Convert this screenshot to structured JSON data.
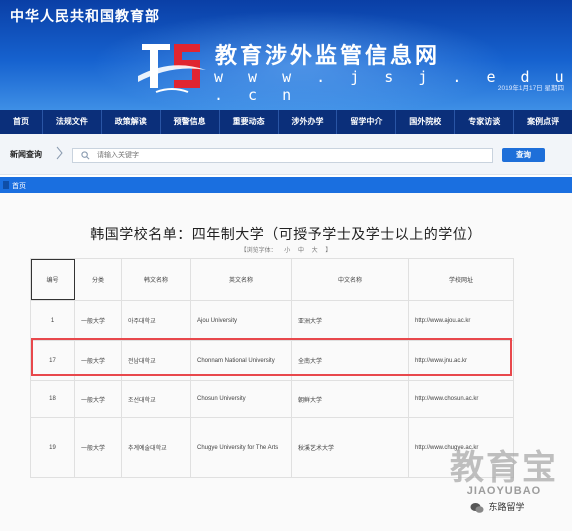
{
  "header": {
    "ministry": "中华人民共和国教育部",
    "site_title": "教育涉外监管信息网",
    "domain": "w w w . j s j . e d u . c n",
    "date": "2019年1月17日 星期四"
  },
  "nav": {
    "items": [
      "首页",
      "法规文件",
      "政策解读",
      "预警信息",
      "重要动态",
      "涉外办学",
      "留学中介",
      "国外院校",
      "专家访谈",
      "案例点评"
    ]
  },
  "search": {
    "label": "新闻查询",
    "placeholder": "请输入关键字",
    "button": "查询"
  },
  "breadcrumb": "首页",
  "page": {
    "title": "韩国学校名单：四年制大学（可授予学士及学士以上的学位）",
    "font_size_label": "【浏览字体：",
    "font_sizes": [
      "小",
      "中",
      "大"
    ],
    "font_size_end": "】"
  },
  "table": {
    "headers": [
      "编号",
      "分类",
      "韩文名称",
      "英文名称",
      "中文名称",
      "学校网址"
    ],
    "rows": [
      [
        "1",
        "一般大学",
        "아주대학교",
        "Ajou University",
        "亚洲大学",
        "http://www.ajou.ac.kr"
      ],
      [
        "17",
        "一般大学",
        "전남대학교",
        "Chonnam National University",
        "全南大学",
        "http://www.jnu.ac.kr"
      ],
      [
        "18",
        "一般大学",
        "조선대학교",
        "Chosun University",
        "朝鲜大学",
        "http://www.chosun.ac.kr"
      ],
      [
        "19",
        "一般大学",
        "추계예술대학교",
        "Chugye University for The Arts",
        "秋溪艺术大学",
        "http://www.chugye.ac.kr"
      ]
    ]
  },
  "watermark": {
    "main": "教育宝",
    "sub": "JIAOYUBAO",
    "wechat": "东路留学"
  },
  "colors": {
    "banner": "#1662cf",
    "nav": "#0b2f7a",
    "crumb": "#1a6fe0",
    "highlight": "#e8484c"
  }
}
